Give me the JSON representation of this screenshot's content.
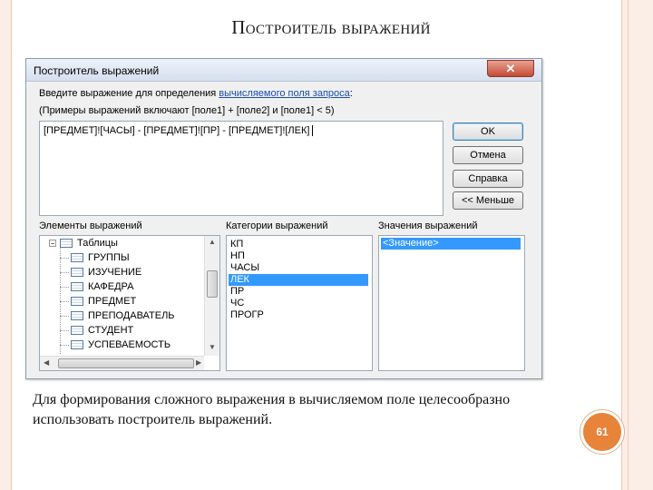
{
  "slide": {
    "title": "Построитель выражений",
    "caption": "Для формирования сложного выражения в вычисляемом поле целесообразно использовать построитель выражений.",
    "page_number": "61"
  },
  "dialog": {
    "title": "Построитель выражений",
    "close_label": "✕",
    "prompt_text": "Введите выражение для определения ",
    "prompt_link": "вычисляемого поля запроса",
    "prompt_end": ":",
    "examples_text": "(Примеры выражений включают [поле1] + [поле2] и [поле1] < 5)",
    "expression_value": "[ПРЕДМЕТ]![ЧАСЫ] - [ПРЕДМЕТ]![ПР] - [ПРЕДМЕТ]![ЛЕК]",
    "buttons": {
      "ok": "OK",
      "cancel": "Отмена",
      "help": "Справка",
      "less": "<< Меньше"
    },
    "columns": {
      "elements": "Элементы выражений",
      "categories": "Категории выражений",
      "values": "Значения выражений"
    },
    "elements_tree": {
      "root": "Таблицы",
      "items": [
        "ГРУППЫ",
        "ИЗУЧЕНИЕ",
        "КАФЕДРА",
        "ПРЕДМЕТ",
        "ПРЕПОДАВАТЕЛЬ",
        "СТУДЕНТ",
        "УСПЕВАЕМОСТЬ"
      ]
    },
    "categories": [
      "КП",
      "НП",
      "ЧАСЫ",
      "ЛЕК",
      "ПР",
      "ЧС",
      "ПРОГР"
    ],
    "selected_category": "ЛЕК",
    "values": [
      "<Значение>"
    ]
  }
}
